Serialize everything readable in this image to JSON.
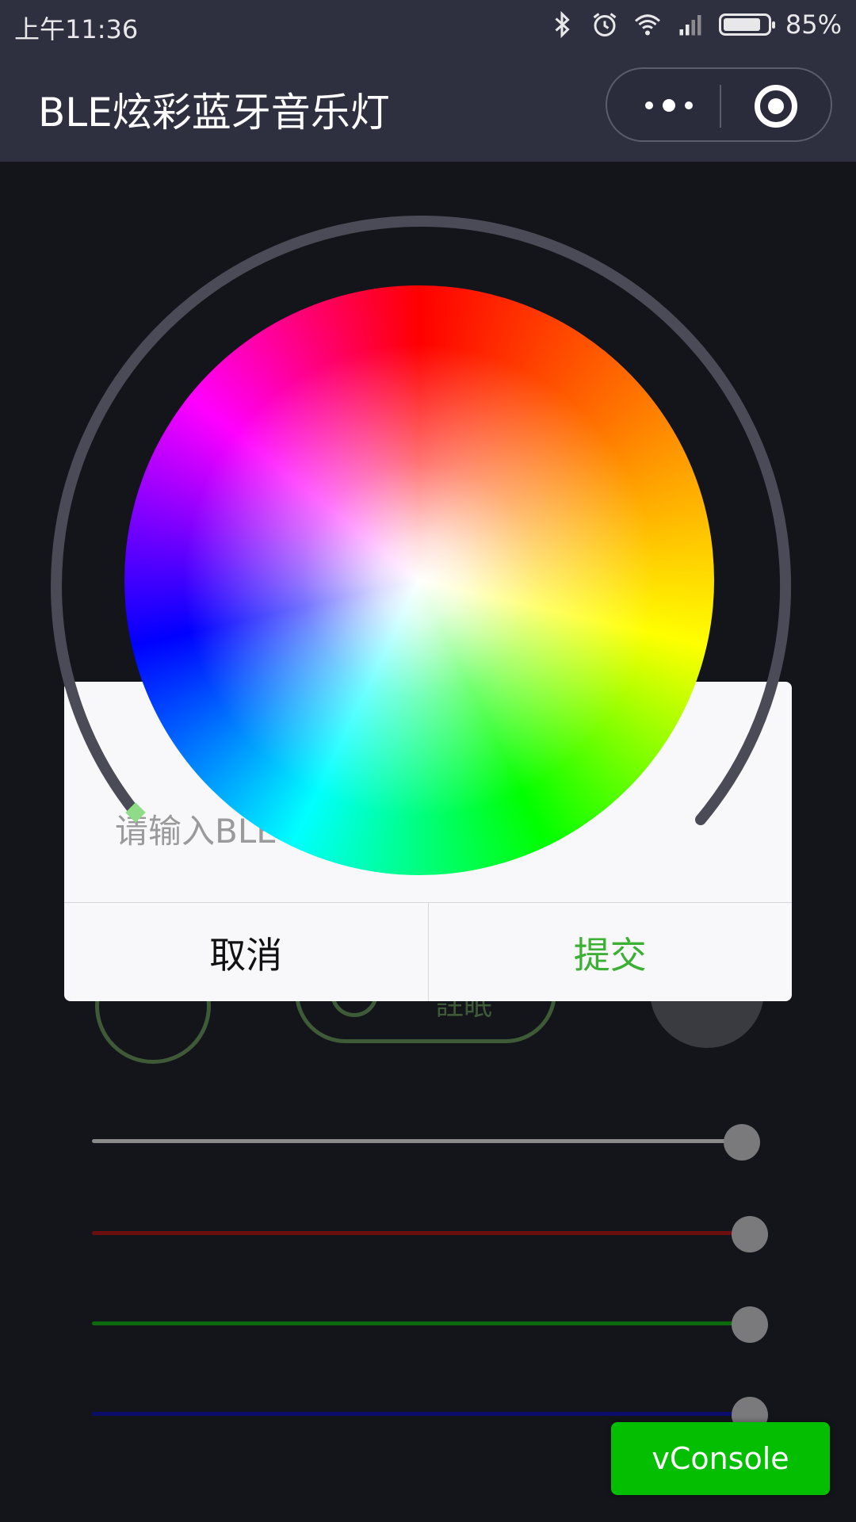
{
  "status_bar": {
    "time": "上午11:36",
    "battery_text": "85%",
    "battery_level": 0.85,
    "icons": [
      "bluetooth-icon",
      "alarm-icon",
      "wifi-icon",
      "hd-signal-icon",
      "battery-icon"
    ]
  },
  "title_bar": {
    "title": "BLE炫彩蓝牙音乐灯",
    "capsule_icons": [
      "more-icon",
      "close-miniprogram-icon"
    ]
  },
  "background_controls": {
    "pill_label": "註眠",
    "icons": [
      "ring-toggle-icon",
      "mode-icon",
      "bluetooth-disabled-icon"
    ]
  },
  "sliders": [
    {
      "name": "brightness",
      "value": 1.0,
      "color": "#8a8a8a"
    },
    {
      "name": "red",
      "value": 1.0,
      "color": "#6b0e0e"
    },
    {
      "name": "green",
      "value": 1.0,
      "color": "#0c6a0c"
    },
    {
      "name": "blue",
      "value": 1.0,
      "color": "#0a0e6a"
    }
  ],
  "dialog": {
    "input_placeholder": "请输入BLE",
    "input_value": "",
    "cancel_label": "取消",
    "submit_label": "提交",
    "submit_color": "#3cb034"
  },
  "color_picker": {
    "ring_color": "#4a4b57",
    "handle_color": "#8fdc88"
  },
  "vconsole": {
    "label": "vConsole",
    "color": "#04be02"
  }
}
